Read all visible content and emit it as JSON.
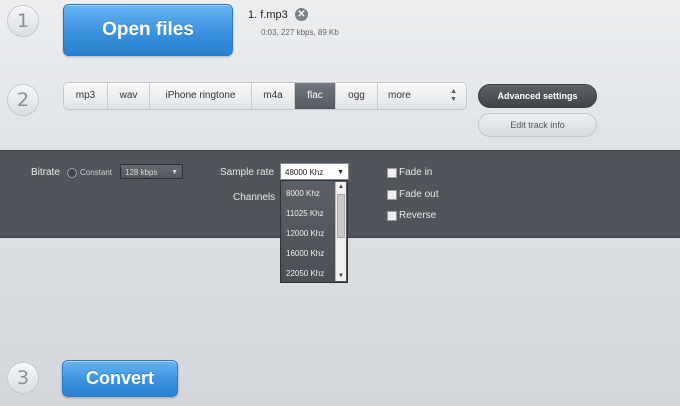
{
  "steps": [
    "1",
    "2",
    "3"
  ],
  "open_files": {
    "label": "Open files"
  },
  "file": {
    "name": "1. f.mp3",
    "meta": "0:03, 227 kbps, 89 Kb",
    "remove_icon": "close-icon"
  },
  "formats": [
    "mp3",
    "wav",
    "iPhone ringtone",
    "m4a",
    "flac",
    "ogg",
    "more"
  ],
  "selected_format": "flac",
  "buttons": {
    "advanced": "Advanced settings",
    "edit_info": "Edit track info"
  },
  "settings": {
    "bitrate_label": "Bitrate",
    "bitrate_mode": "Constant",
    "bitrate_value": "128 kbps",
    "sample_rate_label": "Sample rate",
    "sample_rate_value": "48000 Khz",
    "channels_label": "Channels",
    "fade_in": "Fade in",
    "fade_out": "Fade out",
    "reverse": "Reverse"
  },
  "sample_rate_options": [
    "8000 Khz",
    "11025 Khz",
    "12000 Khz",
    "16000 Khz",
    "22050 Khz"
  ],
  "convert": {
    "label": "Convert"
  },
  "colors": {
    "accent": "#3c92de",
    "panel": "#4f555b",
    "active_tab": "#5c6268"
  }
}
